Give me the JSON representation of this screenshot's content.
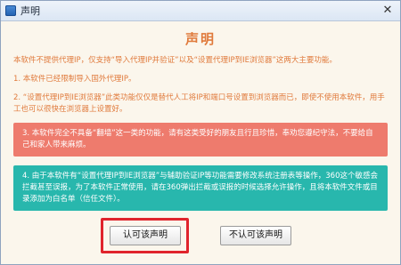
{
  "window": {
    "title": "声明",
    "close_glyph": "✕"
  },
  "content": {
    "heading": "声明",
    "intro": "本软件不提供代理IP，仅支持“导入代理IP并验证”以及“设置代理IP到IE浏览器”这两大主要功能。",
    "item1": "1.  本软件已经限制导入国外代理IP。",
    "item2": "2.  “设置代理IP到IE浏览器”此类功能仅仅是替代人工将IP和端口号设置到浏览器而已，即使不使用本软件，用手工也可以很快在浏览器上设置好。",
    "item3": "3.  本软件完全不具备“翻墙”这一类的功能，请有这类受好的朋友且行且珍惜，奉劝您遵纪守法，不要给自己和家人带来麻烦。",
    "item4": "4.  由于本软件有“设置代理IP到IE浏览器”与辅助验证IP等功能需要修改系统注册表等操作，360这个敏感会拦截甚至误报，为了本软件正常使用，请在360弹出拦截或误报的时候选择允许操作，且将本软件文件或目录添加为白名单（信任文件）。"
  },
  "buttons": {
    "accept": "认可该声明",
    "decline": "不认可该声明"
  },
  "colors": {
    "text_orange": "#e07a3c",
    "box_red": "#ee7b6d",
    "box_teal": "#28b7ad",
    "focus_ring": "#e0242c"
  }
}
